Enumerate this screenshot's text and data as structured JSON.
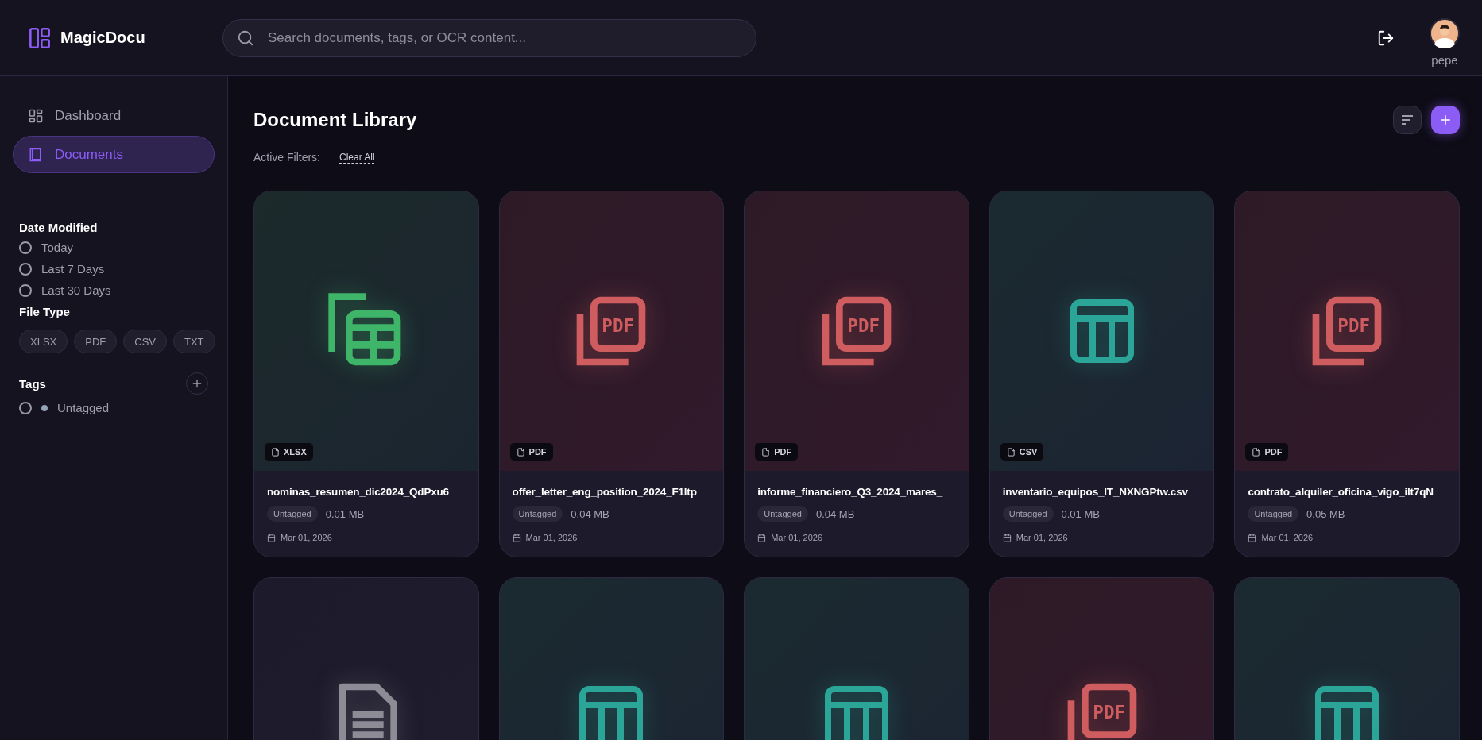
{
  "app": {
    "name": "MagicDocu"
  },
  "search": {
    "placeholder": "Search documents, tags, or OCR content..."
  },
  "user": {
    "name": "pepe"
  },
  "nav": [
    {
      "label": "Dashboard",
      "kind": "dashboard",
      "selected": false
    },
    {
      "label": "Documents",
      "kind": "documents",
      "selected": true
    }
  ],
  "filters": {
    "date_title": "Date Modified",
    "dates": [
      {
        "label": "Today",
        "selected": false
      },
      {
        "label": "Last 7 Days",
        "selected": false
      },
      {
        "label": "Last 30 Days",
        "selected": false
      }
    ],
    "type_title": "File Type",
    "types": [
      "XLSX",
      "PDF",
      "CSV",
      "TXT"
    ],
    "tags_title": "Tags",
    "tags": [
      {
        "label": "Untagged",
        "color": "#94a3b8",
        "selected": false
      }
    ]
  },
  "library": {
    "title": "Document Library",
    "active_filters": "Active Filters:",
    "clear": "Clear All"
  },
  "cards": [
    {
      "kind": "xlsx",
      "badge": "XLSX",
      "name": "nominas_resumen_dic2024_QdPxu6",
      "tag": "Untagged",
      "size": "0.01 MB",
      "date": "Mar 01, 2026"
    },
    {
      "kind": "pdf",
      "icon_text": "PDF",
      "badge": "PDF",
      "name": "offer_letter_eng_position_2024_F1ltp",
      "tag": "Untagged",
      "size": "0.04 MB",
      "date": "Mar 01, 2026"
    },
    {
      "kind": "pdf",
      "icon_text": "PDF",
      "badge": "PDF",
      "name": "informe_financiero_Q3_2024_mares_",
      "tag": "Untagged",
      "size": "0.04 MB",
      "date": "Mar 01, 2026"
    },
    {
      "kind": "csv",
      "badge": "CSV",
      "name": "inventario_equipos_IT_NXNGPtw.csv",
      "tag": "Untagged",
      "size": "0.01 MB",
      "date": "Mar 01, 2026"
    },
    {
      "kind": "pdf",
      "icon_text": "PDF",
      "badge": "PDF",
      "name": "contrato_alquiler_oficina_vigo_ilt7qN",
      "tag": "Untagged",
      "size": "0.05 MB",
      "date": "Mar 01, 2026"
    },
    {
      "kind": "txt"
    },
    {
      "kind": "csv"
    },
    {
      "kind": "csv"
    },
    {
      "kind": "pdf",
      "icon_text": "PDF"
    },
    {
      "kind": "csv"
    }
  ]
}
